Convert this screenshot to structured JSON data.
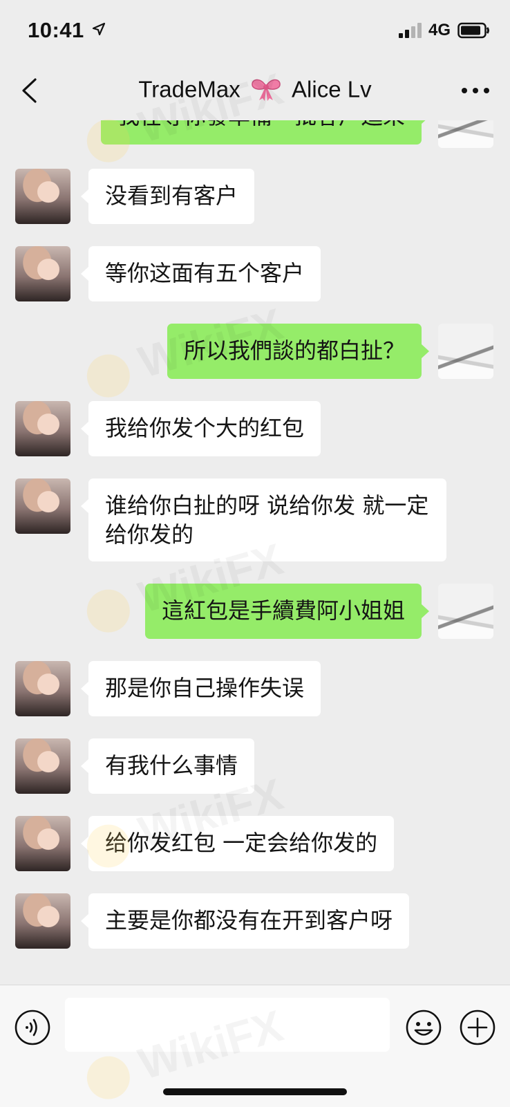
{
  "status_bar": {
    "time": "10:41",
    "network": "4G",
    "location_icon": "location-arrow-icon",
    "signal_icon": "signal-icon",
    "battery_icon": "battery-icon"
  },
  "nav": {
    "title_left": "TradeMax",
    "title_icon": "ribbon-bow-icon",
    "title_right": "Alice Lv",
    "back_icon": "chevron-left-icon",
    "more_icon": "more-dots-icon"
  },
  "messages": [
    {
      "sender": "self",
      "text": "我在等你發準備一批客户進來",
      "partial": true
    },
    {
      "sender": "contact",
      "text": "没看到有客户"
    },
    {
      "sender": "contact",
      "text": "等你这面有五个客户"
    },
    {
      "sender": "self",
      "text": "所以我們談的都白扯？"
    },
    {
      "sender": "contact",
      "text": "我给你发个大的红包"
    },
    {
      "sender": "contact",
      "text": "谁给你白扯的呀  说给你发 就一定给你发的"
    },
    {
      "sender": "self",
      "text": "這紅包是手續費阿小姐姐"
    },
    {
      "sender": "contact",
      "text": "那是你自己操作失误"
    },
    {
      "sender": "contact",
      "text": "有我什么事情"
    },
    {
      "sender": "contact",
      "text": "给你发红包 一定会给你发的"
    },
    {
      "sender": "contact",
      "text": "主要是你都没有在开到客户呀"
    }
  ],
  "input_bar": {
    "voice_icon": "voice-icon",
    "emoji_icon": "emoji-icon",
    "plus_icon": "plus-icon",
    "message_value": ""
  },
  "watermark": "WikiFX",
  "colors": {
    "background": "#ededed",
    "self_bubble": "#95ec69",
    "contact_bubble": "#ffffff",
    "input_bar": "#f7f7f7"
  }
}
